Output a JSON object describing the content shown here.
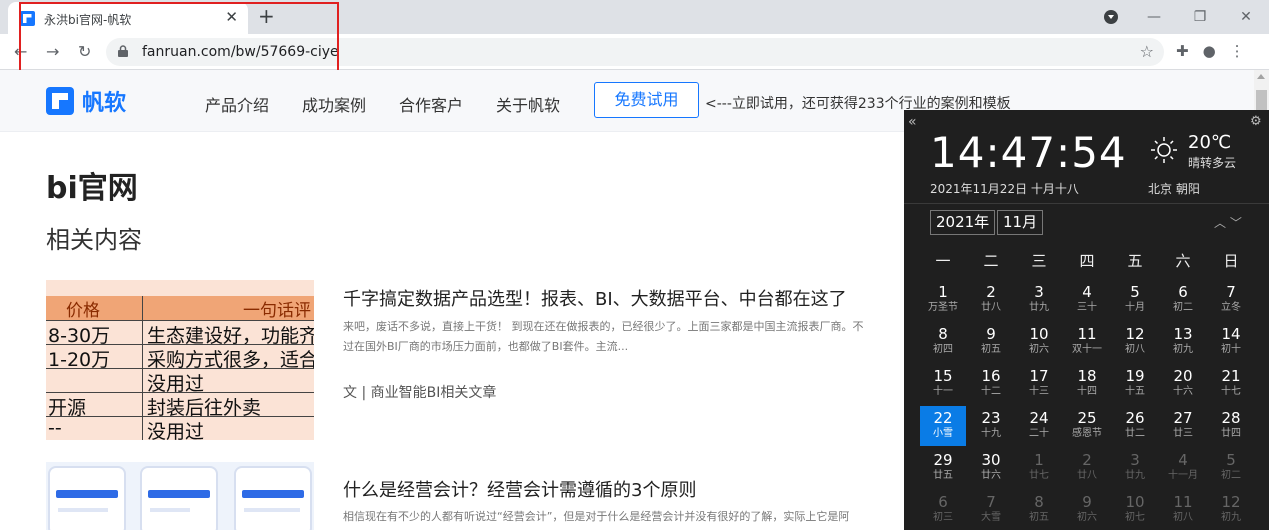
{
  "browser": {
    "tab_title": "永洪bi官网-帆软",
    "tab_close": "✕",
    "new_tab": "+",
    "url": "fanruan.com/bw/57669-ciye",
    "window": {
      "minimize": "—",
      "restore": "❐",
      "close": "✕"
    }
  },
  "site": {
    "logo_text": "帆软",
    "menu": [
      "产品介绍",
      "成功案例",
      "合作客户",
      "关于帆软"
    ],
    "trial_button": "免费试用",
    "trial_tip": "<---立即试用，还可获得233个行业的案例和模板"
  },
  "main": {
    "page_title": "bi官网",
    "section_title": "相关内容",
    "articles": [
      {
        "title": "千字搞定数据产品选型！报表、BI、大数据平台、中台都在这了",
        "desc_line1": "来吧，废话不多说，直接上干货！ 到现在还在做报表的，已经很少了。上面三家都是中国主流报表厂商。不",
        "desc_line2": "过在国外BI厂商的市场压力面前，也都做了BI套件。主流...",
        "meta": "文 | 商业智能BI相关文章"
      },
      {
        "title": "什么是经营会计？经营会计需遵循的3个原则",
        "desc_line1": "相信现在有不少的人都有听说过“经营会计”，但是对于什么是经营会计并没有很好的了解，实际上它是阿"
      }
    ],
    "thumb_table": {
      "header": [
        "价格",
        "一句话评"
      ],
      "rows": [
        [
          "8-30万",
          "生态建设好，功能齐"
        ],
        [
          "1-20万",
          "采购方式很多，适合"
        ],
        [
          "",
          "没用过"
        ],
        [
          "开源",
          "封装后往外卖"
        ],
        [
          "--",
          "没用过"
        ]
      ]
    }
  },
  "calendar": {
    "time": "14:47:54",
    "date": "2021年11月22日 十月十八",
    "temp": "20℃",
    "weather": "晴转多云",
    "location": "北京 朝阳",
    "year": "2021年",
    "month": "11月",
    "weekdays": [
      "一",
      "二",
      "三",
      "四",
      "五",
      "六",
      "日"
    ],
    "days": [
      {
        "n": "1",
        "l": "万圣节"
      },
      {
        "n": "2",
        "l": "廿八"
      },
      {
        "n": "3",
        "l": "廿九"
      },
      {
        "n": "4",
        "l": "三十"
      },
      {
        "n": "5",
        "l": "十月"
      },
      {
        "n": "6",
        "l": "初二"
      },
      {
        "n": "7",
        "l": "立冬"
      },
      {
        "n": "8",
        "l": "初四"
      },
      {
        "n": "9",
        "l": "初五"
      },
      {
        "n": "10",
        "l": "初六"
      },
      {
        "n": "11",
        "l": "双十一"
      },
      {
        "n": "12",
        "l": "初八"
      },
      {
        "n": "13",
        "l": "初九"
      },
      {
        "n": "14",
        "l": "初十"
      },
      {
        "n": "15",
        "l": "十一"
      },
      {
        "n": "16",
        "l": "十二"
      },
      {
        "n": "17",
        "l": "十三"
      },
      {
        "n": "18",
        "l": "十四"
      },
      {
        "n": "19",
        "l": "十五"
      },
      {
        "n": "20",
        "l": "十六"
      },
      {
        "n": "21",
        "l": "十七"
      },
      {
        "n": "22",
        "l": "小雪",
        "today": true
      },
      {
        "n": "23",
        "l": "十九"
      },
      {
        "n": "24",
        "l": "二十"
      },
      {
        "n": "25",
        "l": "感恩节"
      },
      {
        "n": "26",
        "l": "廿二"
      },
      {
        "n": "27",
        "l": "廿三"
      },
      {
        "n": "28",
        "l": "廿四"
      },
      {
        "n": "29",
        "l": "廿五"
      },
      {
        "n": "30",
        "l": "廿六"
      },
      {
        "n": "1",
        "l": "廿七",
        "other": true
      },
      {
        "n": "2",
        "l": "廿八",
        "other": true
      },
      {
        "n": "3",
        "l": "廿九",
        "other": true
      },
      {
        "n": "4",
        "l": "十一月",
        "other": true
      },
      {
        "n": "5",
        "l": "初二",
        "other": true
      },
      {
        "n": "6",
        "l": "初三",
        "other": true
      },
      {
        "n": "7",
        "l": "大雪",
        "other": true
      },
      {
        "n": "8",
        "l": "初五",
        "other": true
      },
      {
        "n": "9",
        "l": "初六",
        "other": true
      },
      {
        "n": "10",
        "l": "初七",
        "other": true
      },
      {
        "n": "11",
        "l": "初八",
        "other": true
      },
      {
        "n": "12",
        "l": "初九",
        "other": true
      }
    ],
    "colors": {
      "bg": "#1f1f1f",
      "today": "#0a7ce6"
    }
  }
}
